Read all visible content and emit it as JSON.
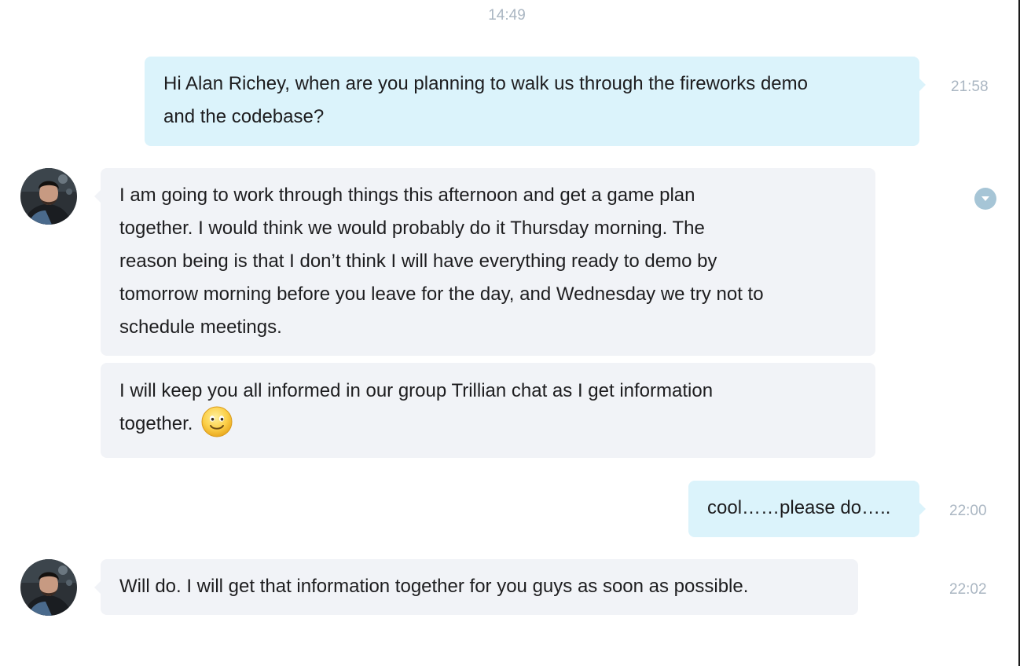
{
  "conversation": {
    "day_time": "14:49",
    "messages": [
      {
        "direction": "outgoing",
        "lines": [
          "Hi Alan Richey, when are you planning to walk us through the fireworks demo",
          "and the codebase?"
        ],
        "time": "21:58"
      },
      {
        "direction": "incoming",
        "lines": [
          "I am going to work through things this afternoon and get a game plan",
          "together. I would think we would probably do it Thursday morning. The",
          "reason being is that I don’t think I will have everything ready to demo by",
          "tomorrow morning before you leave for the day, and Wednesday we try not to",
          "schedule meetings."
        ]
      },
      {
        "direction": "incoming",
        "lines": [
          "I will keep you all informed in our group Trillian chat as I get information",
          "together."
        ],
        "emoji": "smiley-emoji-icon"
      },
      {
        "direction": "outgoing",
        "lines": [
          "cool……please do….."
        ],
        "time": "22:00"
      },
      {
        "direction": "incoming",
        "lines": [
          "Will do. I will get that information together for you guys as soon as possible."
        ],
        "time": "22:02"
      }
    ],
    "icons": {
      "avatar": "contact-avatar",
      "message_menu": "chevron-down-icon"
    },
    "colors": {
      "outgoing_bubble": "#dbf3fb",
      "incoming_bubble": "#f1f3f7",
      "timestamp": "#aab6c2",
      "menu_button": "#a6c5d6"
    }
  }
}
